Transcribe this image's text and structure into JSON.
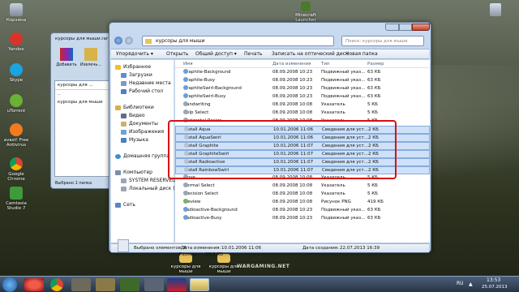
{
  "desktop": {
    "icons_left": [
      {
        "label": "Корзина"
      },
      {
        "label": "Yandex"
      },
      {
        "label": "Skype"
      },
      {
        "label": "uTorrent"
      },
      {
        "label": "avast! Free Antivirus"
      },
      {
        "label": "Google Chrome"
      },
      {
        "label": "Camtasia Studio 7"
      }
    ],
    "top_shortcut": "Minecraft Launcher",
    "bottom_folders": [
      {
        "label": "курсоры для мыши"
      },
      {
        "label": "курсоры для мыши"
      }
    ],
    "wallpaper_logo": "WARGAMING.NET"
  },
  "small_window": {
    "title": "курсоры для мыши.rar",
    "btn_add": "Добавить",
    "btn_extract": "Извлечь...",
    "path": "курсоры для ...",
    "rows": [
      "..",
      "курсоры для мыши"
    ],
    "status": "Выбрано 1 папка"
  },
  "window": {
    "address": "курсоры для мыши",
    "search_placeholder": "Поиск: курсоры для мыши",
    "toolbar": [
      "Упорядочить ▾",
      "Открыть",
      "Общий доступ ▾",
      "Печать",
      "Записать на оптический диск",
      "Новая папка"
    ],
    "nav": [
      {
        "label": "Избранное",
        "head": true
      },
      {
        "label": "Загрузки"
      },
      {
        "label": "Недавние места"
      },
      {
        "label": "Рабочий стол"
      },
      {
        "label": "Библиотеки",
        "head": true
      },
      {
        "label": "Видео"
      },
      {
        "label": "Документы"
      },
      {
        "label": "Изображения"
      },
      {
        "label": "Музыка"
      },
      {
        "label": "Домашняя группа",
        "head": true
      },
      {
        "label": "Компьютер",
        "head": true
      },
      {
        "label": "SYSTEM RESERVED (C:)"
      },
      {
        "label": "Локальный диск (D:)"
      },
      {
        "label": "Сеть",
        "head": true
      }
    ],
    "columns": [
      "Имя",
      "Дата изменения",
      "Тип",
      "Размер"
    ],
    "files": [
      {
        "name": "Graphite-Background",
        "date": "08.09.2008 10:23",
        "type": "Подвижный указ...",
        "size": "63 КБ",
        "sel": false
      },
      {
        "name": "Graphite-Busy",
        "date": "08.09.2008 10:23",
        "type": "Подвижный указ...",
        "size": "63 КБ",
        "sel": false
      },
      {
        "name": "GraphiteSwirl-Background",
        "date": "08.09.2008 10:23",
        "type": "Подвижный указ...",
        "size": "63 КБ",
        "sel": false
      },
      {
        "name": "GraphiteSwirl-Busy",
        "date": "08.09.2008 10:23",
        "type": "Подвижный указ...",
        "size": "63 КБ",
        "sel": false
      },
      {
        "name": "Handwriting",
        "date": "08.09.2008 10:08",
        "type": "Указатель",
        "size": "5 КБ",
        "sel": false
      },
      {
        "name": "Help Select",
        "date": "08.09.2008 10:08",
        "type": "Указатель",
        "size": "5 КБ",
        "sel": false
      },
      {
        "name": "Horizontal Resize",
        "date": "08.09.2008 10:08",
        "type": "Указатель",
        "size": "5 КБ",
        "sel": false
      },
      {
        "name": "Install Aqua",
        "date": "10.01.2006 11:06",
        "type": "Сведения для уст...",
        "size": "2 КБ",
        "sel": true
      },
      {
        "name": "Install AquaSwirl",
        "date": "10.01.2006 11:06",
        "type": "Сведения для уст...",
        "size": "2 КБ",
        "sel": true
      },
      {
        "name": "Install Graphite",
        "date": "10.01.2006 11:07",
        "type": "Сведения для уст...",
        "size": "2 КБ",
        "sel": true
      },
      {
        "name": "Install GraphiteSwirl",
        "date": "10.01.2006 11:07",
        "type": "Сведения для уст...",
        "size": "2 КБ",
        "sel": true
      },
      {
        "name": "Install Radioactive",
        "date": "10.01.2006 11:07",
        "type": "Сведения для уст...",
        "size": "2 КБ",
        "sel": true
      },
      {
        "name": "Install RainbowSwirl",
        "date": "10.01.2006 11:07",
        "type": "Сведения для уст...",
        "size": "2 КБ",
        "sel": true
      },
      {
        "name": "Move",
        "date": "08.09.2008 10:08",
        "type": "Указатель",
        "size": "5 КБ",
        "sel": false
      },
      {
        "name": "Normal Select",
        "date": "08.09.2008 10:08",
        "type": "Указатель",
        "size": "5 КБ",
        "sel": false
      },
      {
        "name": "Precision Select",
        "date": "08.09.2008 10:08",
        "type": "Указатель",
        "size": "5 КБ",
        "sel": false
      },
      {
        "name": "Preview",
        "date": "08.09.2008 10:08",
        "type": "Рисунок PNG",
        "size": "419 КБ",
        "sel": false
      },
      {
        "name": "Radioactive-Background",
        "date": "08.09.2008 10:23",
        "type": "Подвижный указ...",
        "size": "63 КБ",
        "sel": false
      },
      {
        "name": "Radioactive-Busy",
        "date": "08.09.2008 10:23",
        "type": "Подвижный указ...",
        "size": "63 КБ",
        "sel": false
      }
    ],
    "status": {
      "selected": "Выбрано элементов: 6",
      "date_label": "Дата изменения:",
      "date_value": "10.01.2006 11:06",
      "size_label": "Размер:",
      "size_value": "10,2 КБ",
      "created_label": "Дата создания:",
      "created_value": "22.07.2013 16:39"
    }
  },
  "taskbar": {
    "lang": "RU",
    "time": "13:53",
    "date": "25.07.2013"
  }
}
